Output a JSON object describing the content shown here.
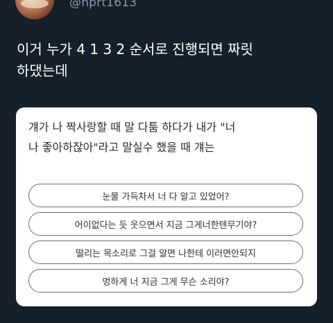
{
  "user": {
    "handle": "@nprt1613",
    "avatar_icon": "profile-photo"
  },
  "tweet": {
    "text_line1": "이거 누가 4 1 3 2 순서로 진행되면 짜릿",
    "text_line2": "하댔는데"
  },
  "card": {
    "question_line1": "걔가 나 짝사랑할 때 말 다툼 하다가 내가 \"너",
    "question_line2": "나 좋아하잖아\"라고 말실수 했을 때 걔는",
    "options": [
      {
        "label": "눈물 가득차서 너 다 알고 있었어?"
      },
      {
        "label": "어이없다는 듯 웃으면서 지금 그게너한텐무기야?"
      },
      {
        "label": "떨리는 목소리로 그걸 알면 나한테 이러면안되지"
      },
      {
        "label": "멍하게 너 지금 그게 무슨 소리야?"
      }
    ]
  }
}
